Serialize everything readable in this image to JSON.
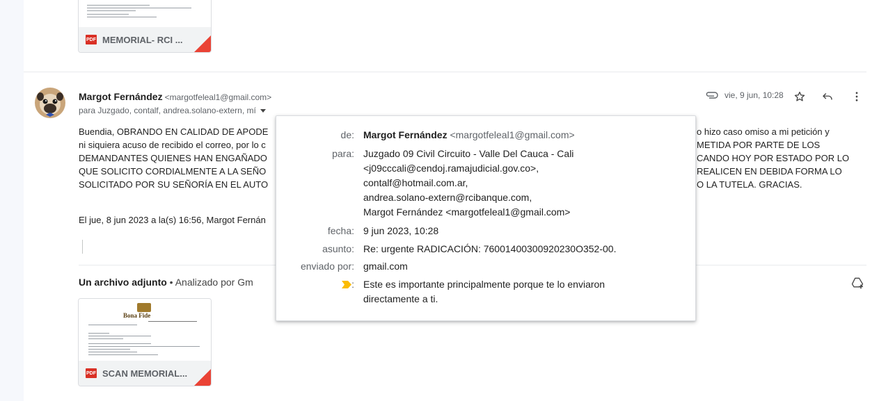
{
  "top_attachment": {
    "name": "MEMORIAL- RCI ...",
    "type": "PDF"
  },
  "message": {
    "sender_name": "Margot Fernández",
    "sender_email": "<margotfeleal1@gmail.com>",
    "recipients_summary": "para Juzgado, contalf, andrea.solano-extern, mí",
    "date": "vie, 9 jun, 10:28",
    "body_lines": [
      "Buendia, OBRANDO EN CALIDAD DE APODE",
      "ni siquiera acuso de recibido el correo, por lo c",
      "DEMANDANTES QUIENES HAN ENGAÑADO",
      "QUE SOLICITO CORDIALMENTE A LA SEÑO",
      "SOLICITADO POR SU SEÑORÍA EN EL AUTO"
    ],
    "body_right_lines": [
      "o hizo caso omiso a mi petición y",
      "METIDA POR PARTE DE LOS",
      "CANDO HOY POR ESTADO POR LO",
      "REALICEN EN DEBIDA FORMA LO",
      "O LA TUTELA. GRACIAS."
    ],
    "quote": "El jue, 8 jun 2023 a la(s) 16:56, Margot Fernán"
  },
  "attachments": {
    "header_bold": "Un archivo adjunto",
    "header_rest": " • Analizado por Gm",
    "items": [
      {
        "name": "SCAN MEMORIAL...",
        "type": "PDF",
        "logo_text": "Bona Fide"
      }
    ]
  },
  "details_popup": {
    "labels": {
      "from": "de:",
      "to": "para:",
      "date": "fecha:",
      "subject": "asunto:",
      "mailed_by": "enviado por:",
      "important": ":"
    },
    "from_name": "Margot Fernández",
    "from_email": "<margotfeleal1@gmail.com>",
    "to_lines": [
      "Juzgado 09 Civil Circuito - Valle Del Cauca - Cali",
      "<j09cccali@cendoj.ramajudicial.gov.co>,",
      "contalf@hotmail.com.ar,",
      "andrea.solano-extern@rcibanque.com,",
      "Margot Fernández <margotfeleal1@gmail.com>"
    ],
    "date": "9 jun 2023, 10:28",
    "subject": "Re: urgente RADICACIÓN: 76001400300920230O352-00.",
    "mailed_by": "gmail.com",
    "important_lines": [
      "Este es importante principalmente porque te lo enviaron",
      "directamente a ti."
    ]
  },
  "colors": {
    "pdf_red": "#d93025",
    "fold_red": "#ea4335",
    "important_yellow": "#fbbc04",
    "rail": "#f6f8fc"
  },
  "icons": [
    "attachment-icon",
    "star-icon",
    "reply-icon",
    "more-vert-icon",
    "add-to-drive-icon",
    "pdf-icon",
    "important-marker-icon"
  ]
}
